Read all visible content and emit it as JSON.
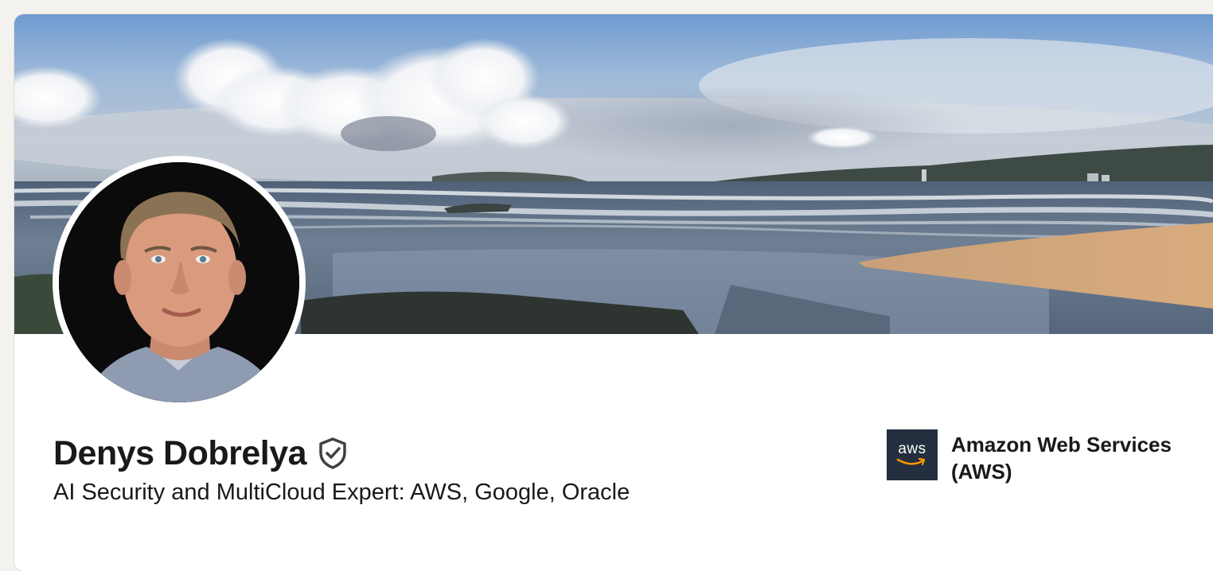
{
  "profile": {
    "name": "Denys Dobrelya",
    "headline": "AI Security and MultiCloud Expert: AWS, Google, Oracle",
    "verified_icon": "verified-shield-icon"
  },
  "company": {
    "logo_text": "aws",
    "name": "Amazon Web Services (AWS)"
  },
  "colors": {
    "page_background": "#f4f2ee",
    "card_background": "#ffffff",
    "text_primary": "#191919",
    "aws_logo_background": "#232f3e",
    "aws_smile": "#ff9900"
  }
}
